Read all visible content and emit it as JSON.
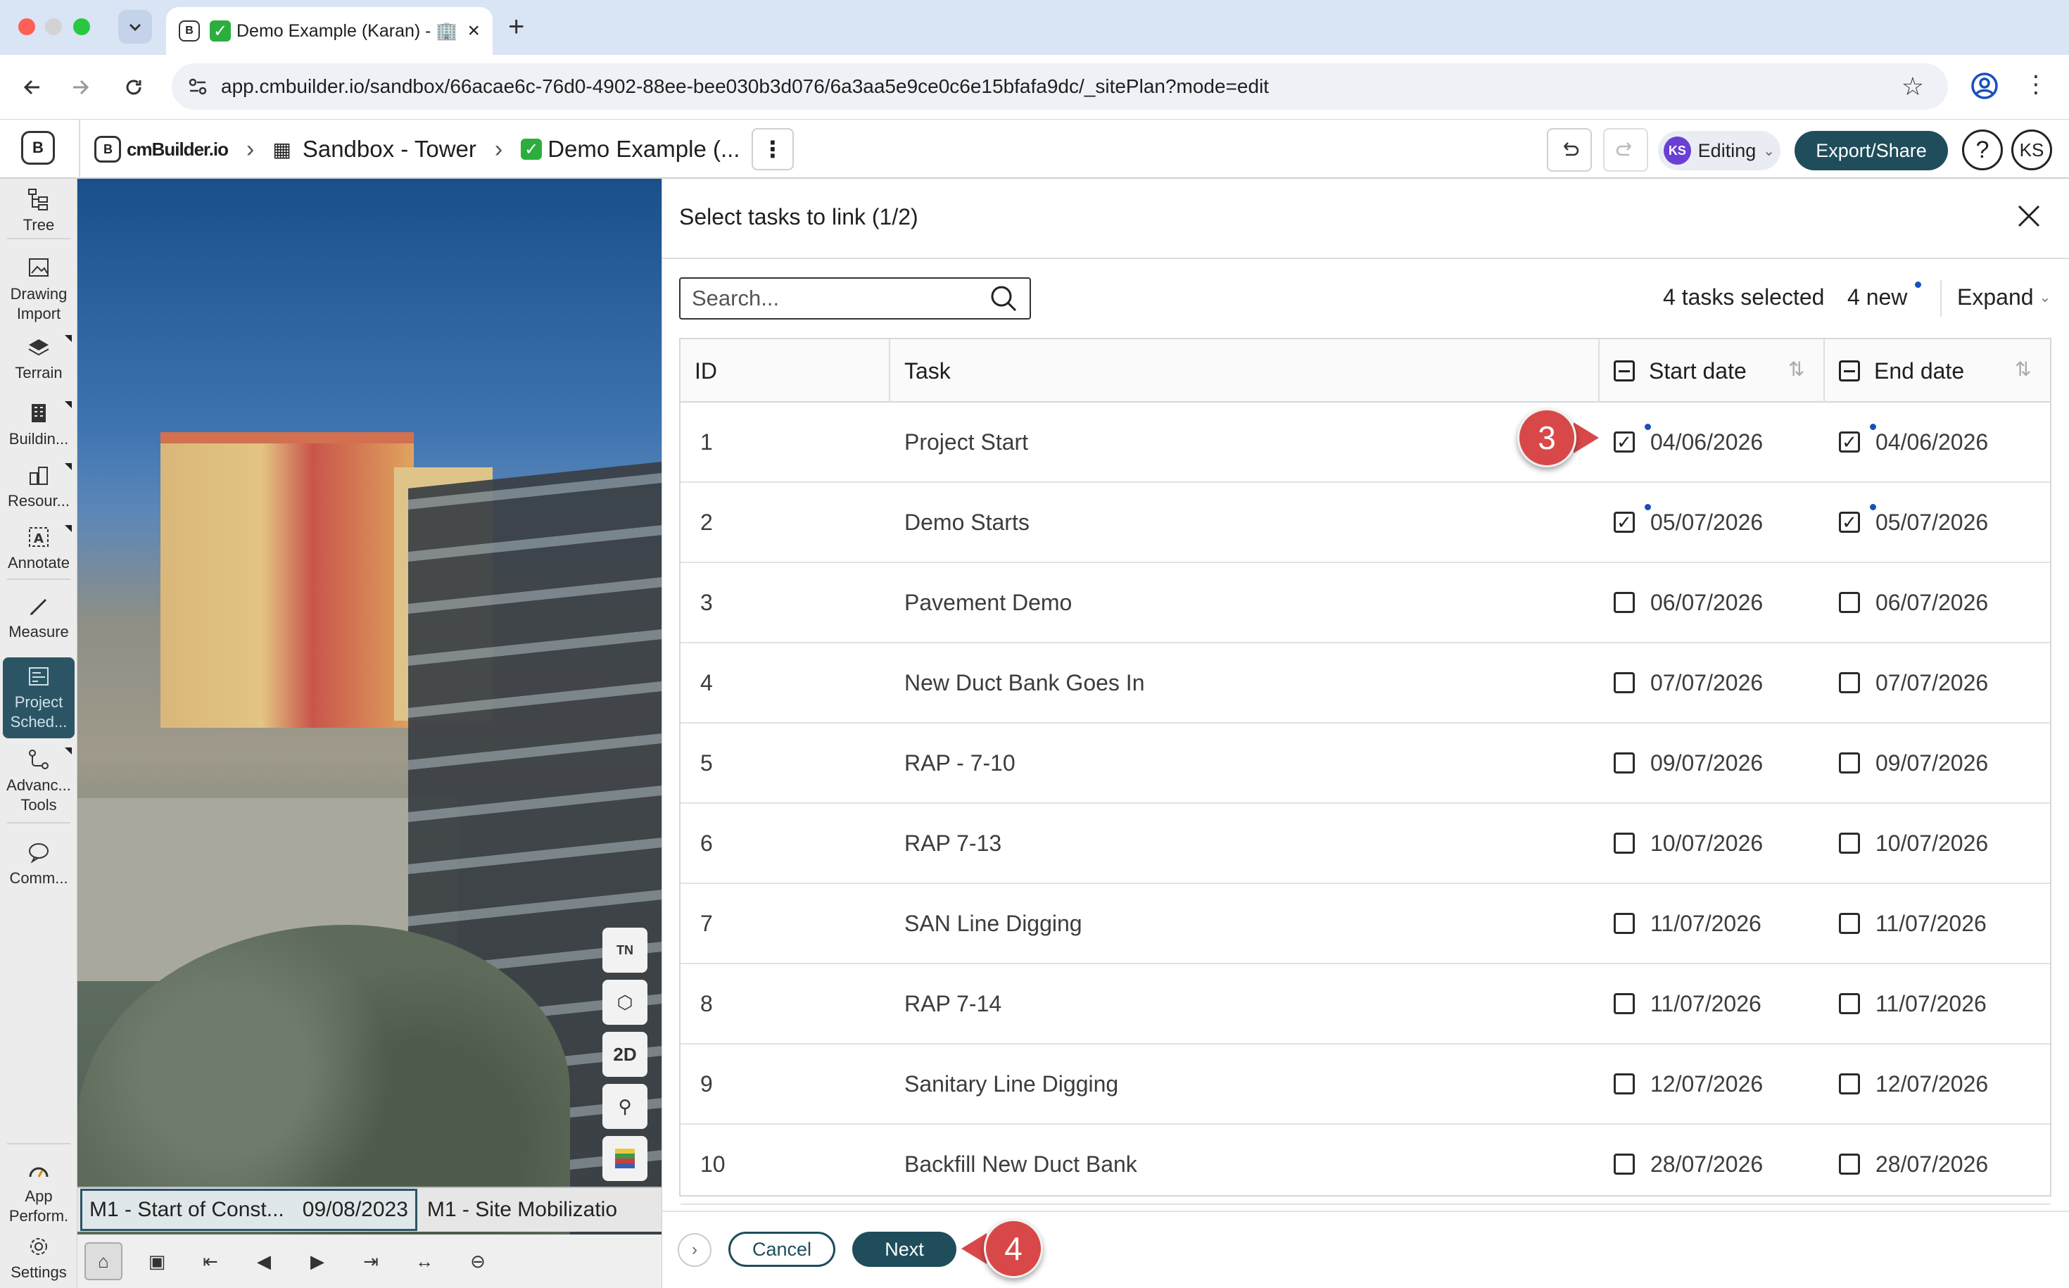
{
  "browser": {
    "tab_title": "Demo Example (Karan) - 🏢",
    "url": "app.cmbuilder.io/sandbox/66acae6c-76d0-4902-88ee-bee030b3d076/6a3aa5e9ce0c6e15bfafa9dc/_sitePlan?mode=edit"
  },
  "app": {
    "brand": "cmBuilder.io",
    "breadcrumb": {
      "project": "Sandbox - Tower",
      "document": "Demo Example (..."
    },
    "mode_label": "Editing",
    "user_initials": "KS",
    "export_label": "Export/Share",
    "help_label": "?"
  },
  "sidebar": {
    "items": [
      {
        "label": "Tree",
        "icon": "tree-icon"
      },
      {
        "label": "Drawing Import",
        "icon": "drawing-import-icon"
      },
      {
        "label": "Terrain",
        "icon": "terrain-icon"
      },
      {
        "label": "Buildin...",
        "icon": "building-icon"
      },
      {
        "label": "Resour...",
        "icon": "resources-icon"
      },
      {
        "label": "Annotate",
        "icon": "annotate-icon"
      },
      {
        "label": "Measure",
        "icon": "measure-icon"
      },
      {
        "label": "Project Sched...",
        "icon": "schedule-icon"
      },
      {
        "label": "Advanc... Tools",
        "icon": "advanced-tools-icon"
      },
      {
        "label": "Comm...",
        "icon": "comments-icon"
      },
      {
        "label": "App Perform.",
        "icon": "performance-icon"
      },
      {
        "label": "Settings",
        "icon": "settings-icon"
      }
    ]
  },
  "viewport": {
    "tools": {
      "north": "TN",
      "view2d": "2D"
    },
    "timeline": {
      "milestone_1": "M1 - Start of Const...",
      "milestone_1_date": "09/08/2023",
      "milestone_2": "M1 - Site Mobilizatio"
    }
  },
  "modal": {
    "title": "Select tasks to link (1/2)",
    "search_placeholder": "Search...",
    "selected_summary": "4 tasks selected",
    "new_summary": "4 new",
    "expand_label": "Expand",
    "columns": {
      "id": "ID",
      "task": "Task",
      "start": "Start date",
      "end": "End date"
    },
    "rows": [
      {
        "id": "1",
        "task": "Project Start",
        "start": "04/06/2026",
        "end": "04/06/2026",
        "start_checked": true,
        "end_checked": true
      },
      {
        "id": "2",
        "task": "Demo Starts",
        "start": "05/07/2026",
        "end": "05/07/2026",
        "start_checked": true,
        "end_checked": true
      },
      {
        "id": "3",
        "task": "Pavement Demo",
        "start": "06/07/2026",
        "end": "06/07/2026",
        "start_checked": false,
        "end_checked": false
      },
      {
        "id": "4",
        "task": "New Duct Bank Goes In",
        "start": "07/07/2026",
        "end": "07/07/2026",
        "start_checked": false,
        "end_checked": false
      },
      {
        "id": "5",
        "task": "RAP - 7-10",
        "start": "09/07/2026",
        "end": "09/07/2026",
        "start_checked": false,
        "end_checked": false
      },
      {
        "id": "6",
        "task": "RAP 7-13",
        "start": "10/07/2026",
        "end": "10/07/2026",
        "start_checked": false,
        "end_checked": false
      },
      {
        "id": "7",
        "task": "SAN Line Digging",
        "start": "11/07/2026",
        "end": "11/07/2026",
        "start_checked": false,
        "end_checked": false
      },
      {
        "id": "8",
        "task": "RAP 7-14",
        "start": "11/07/2026",
        "end": "11/07/2026",
        "start_checked": false,
        "end_checked": false
      },
      {
        "id": "9",
        "task": "Sanitary Line Digging",
        "start": "12/07/2026",
        "end": "12/07/2026",
        "start_checked": false,
        "end_checked": false
      },
      {
        "id": "10",
        "task": "Backfill New Duct Bank",
        "start": "28/07/2026",
        "end": "28/07/2026",
        "start_checked": false,
        "end_checked": false
      }
    ],
    "cancel_label": "Cancel",
    "next_label": "Next"
  },
  "callouts": {
    "step_3": "3",
    "step_4": "4"
  },
  "colors": {
    "accent": "#1f4d5b",
    "callout": "#d84848",
    "new_indicator": "#1a4fbf"
  }
}
